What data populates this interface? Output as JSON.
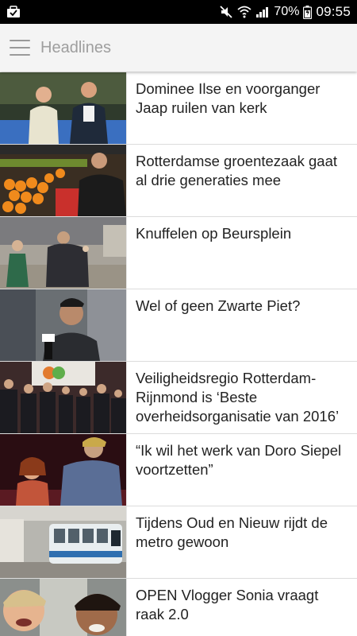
{
  "status_bar": {
    "battery_percent": "70%",
    "time": "09:55",
    "icons": [
      "notification-icon",
      "mute-icon",
      "wifi-icon",
      "signal-icon",
      "battery-icon"
    ]
  },
  "app_bar": {
    "menu_icon": "hamburger-menu-icon",
    "title": "Headlines"
  },
  "headlines": [
    {
      "title": "Dominee Ilse en voorganger Jaap ruilen van kerk",
      "thumbnail": "two presenters in a church"
    },
    {
      "title": "Rotterdamse groentezaak gaat al drie generaties mee",
      "thumbnail": "vegetable shop with oranges"
    },
    {
      "title": "Knuffelen op Beursplein",
      "thumbnail": "people hugging on a street"
    },
    {
      "title": "Wel of geen Zwarte Piet?",
      "thumbnail": "man being interviewed"
    },
    {
      "title": "Veiligheidsregio Rotterdam-Rijnmond is ‘Beste overheidsorganisatie van 2016’",
      "thumbnail": "group of officials on stage"
    },
    {
      "title": "“Ik wil het werk van Doro Siepel voortzetten”",
      "thumbnail": "theatre performance"
    },
    {
      "title": "Tijdens Oud en Nieuw rijdt de metro gewoon",
      "thumbnail": "metro at a station"
    },
    {
      "title": "OPEN Vlogger Sonia vraagt raak 2.0",
      "thumbnail": "two laughing women"
    }
  ],
  "colors": {
    "status_bar_bg": "#000000",
    "app_bar_bg": "#f4f4f4",
    "title_color": "#9e9e9e",
    "text_color": "#222222"
  }
}
